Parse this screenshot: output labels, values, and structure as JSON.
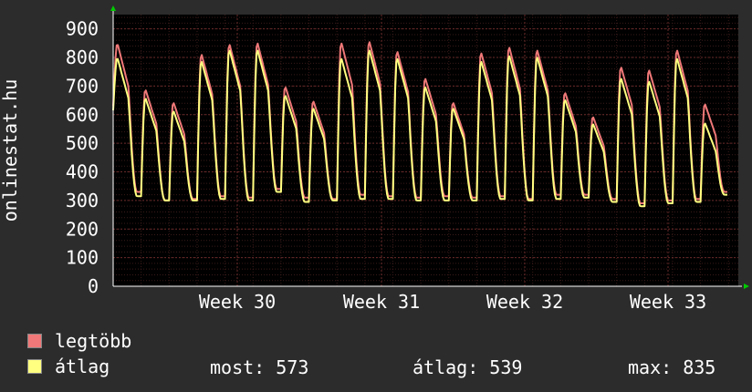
{
  "chart_data": {
    "type": "line",
    "ylabel": "onlinestat.hu",
    "ylim": [
      0,
      950
    ],
    "yticks": [
      0,
      100,
      200,
      300,
      400,
      500,
      600,
      700,
      800,
      900
    ],
    "xticks": [
      "Week 30",
      "Week 31",
      "Week 32",
      "Week 33"
    ],
    "grid": true,
    "colors": {
      "background": "#2c2c2c",
      "plot": "#000000",
      "grid": "#5a2a2a",
      "legtobb": "#f07878",
      "atlag": "#ffff80",
      "axis_arrow": "#00cc00"
    },
    "series": [
      {
        "name": "legtöbb",
        "color": "#f07878",
        "peaks": [
          850,
          690,
          645,
          815,
          850,
          855,
          700,
          650,
          855,
          860,
          825,
          730,
          645,
          820,
          840,
          830,
          680,
          595,
          770,
          760,
          830,
          640
        ],
        "troughs": [
          330,
          300,
          305,
          315,
          310,
          340,
          310,
          305,
          320,
          315,
          310,
          315,
          310,
          315,
          305,
          320,
          320,
          305,
          290,
          300,
          305,
          330
        ]
      },
      {
        "name": "átlag",
        "color": "#ffff80",
        "peaks": [
          800,
          660,
          615,
          790,
          830,
          830,
          670,
          625,
          800,
          830,
          800,
          700,
          625,
          790,
          810,
          805,
          655,
          570,
          730,
          720,
          800,
          573
        ],
        "troughs": [
          315,
          300,
          300,
          305,
          300,
          330,
          295,
          300,
          305,
          305,
          300,
          300,
          300,
          305,
          300,
          305,
          310,
          295,
          280,
          290,
          295,
          320
        ]
      }
    ]
  },
  "legend": {
    "max_label": "legtöbb",
    "avg_label": "átlag",
    "now_text": "most: 573",
    "avg_text": "átlag: 539",
    "max_text": "max: 835"
  }
}
